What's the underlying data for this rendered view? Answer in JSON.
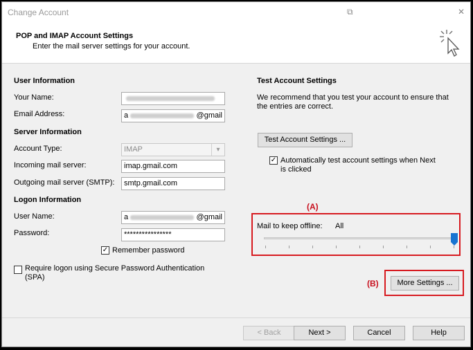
{
  "window": {
    "title": "Change Account",
    "restore_glyph": "⧉",
    "close_glyph": "✕"
  },
  "header": {
    "title": "POP and IMAP Account Settings",
    "subtitle": "Enter the mail server settings for your account."
  },
  "user_info": {
    "heading": "User Information",
    "your_name_label": "Your Name:",
    "email_label": "Email Address:",
    "email_suffix": "@gmail",
    "email_prefix_char": "a"
  },
  "server_info": {
    "heading": "Server Information",
    "account_type_label": "Account Type:",
    "account_type_value": "IMAP",
    "incoming_label": "Incoming mail server:",
    "incoming_value": "imap.gmail.com",
    "outgoing_label": "Outgoing mail server (SMTP):",
    "outgoing_value": "smtp.gmail.com"
  },
  "logon_info": {
    "heading": "Logon Information",
    "username_label": "User Name:",
    "username_suffix": "@gmail",
    "username_prefix_char": "a",
    "password_label": "Password:",
    "password_value": "****************",
    "remember_label": "Remember password",
    "remember_checked": true,
    "spa_label_line1": "Require logon using Secure Password Authentication",
    "spa_label_line2": "(SPA)",
    "spa_checked": false
  },
  "test_settings": {
    "heading": "Test Account Settings",
    "desc_line1": "We recommend that you test your account to ensure that",
    "desc_line2": "the entries are correct.",
    "test_button": "Test Account Settings ...",
    "auto_test_line1": "Automatically test account settings when Next",
    "auto_test_line2": "is clicked",
    "auto_test_checked": true
  },
  "offline": {
    "annotation": "(A)",
    "label": "Mail to keep offline:",
    "value": "All",
    "slider_level": 1.0
  },
  "more_settings": {
    "annotation": "(B)",
    "button": "More Settings ..."
  },
  "footer": {
    "back": "< Back",
    "next": "Next >",
    "cancel": "Cancel",
    "help": "Help"
  },
  "colors": {
    "annotation_red": "#d7191f",
    "slider_blue": "#1874d1"
  }
}
